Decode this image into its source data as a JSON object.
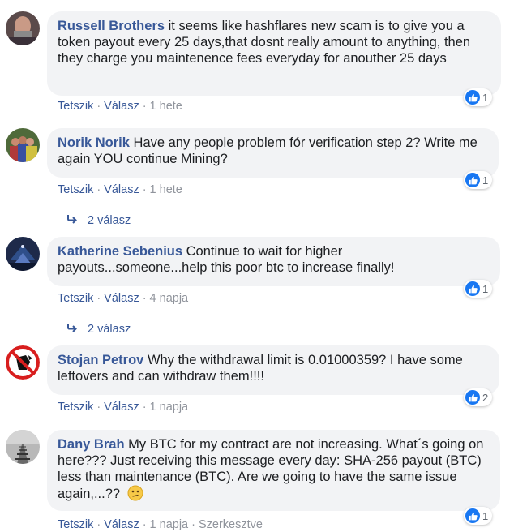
{
  "comments": [
    {
      "name": "Russell Brothers",
      "text": "it seems like hashflares new scam is to give you a token payout every 25 days,that dosnt really amount to anything, then they charge you maintenence fees everyday for anouther 25 days",
      "like_label": "Tetszik",
      "reply_label": "Válasz",
      "time": "1 hete",
      "reaction_count": "1",
      "edited": ""
    },
    {
      "name": "Norik Norik",
      "text": "Have any people problem fór verification step 2? Write me again YOU continue Mining?",
      "like_label": "Tetszik",
      "reply_label": "Válasz",
      "time": "1 hete",
      "reaction_count": "1",
      "replies": "2 válasz"
    },
    {
      "name": "Katherine Sebenius",
      "text": "Continue to wait for higher payouts...someone...help this poor btc to increase finally!",
      "like_label": "Tetszik",
      "reply_label": "Válasz",
      "time": "4 napja",
      "reaction_count": "1",
      "replies": "2 válasz"
    },
    {
      "name": "Stojan Petrov",
      "text": "Why the withdrawal limit is 0.01000359? I have some leftovers and can withdraw them!!!!",
      "like_label": "Tetszik",
      "reply_label": "Válasz",
      "time": "1 napja",
      "reaction_count": "2"
    },
    {
      "name": "Dany Brah",
      "text": "My BTC for my contract are not increasing. What´s going on here??? Just receiving this message every day: SHA-256 payout (BTC) less than maintenance (BTC). Are we going to have the same issue again,...??",
      "like_label": "Tetszik",
      "reply_label": "Válasz",
      "time": "1 napja",
      "edited": "Szerkesztve",
      "reaction_count": "1"
    }
  ],
  "icons": {
    "reaction": "thumbs-up-icon",
    "reply_arrow": "reply-arrow-icon",
    "emoji": "confused-face-emoji"
  },
  "colors": {
    "name": "#385898",
    "bubble": "#f2f3f5",
    "like_badge": "#1877f2",
    "meta": "#90949c"
  }
}
